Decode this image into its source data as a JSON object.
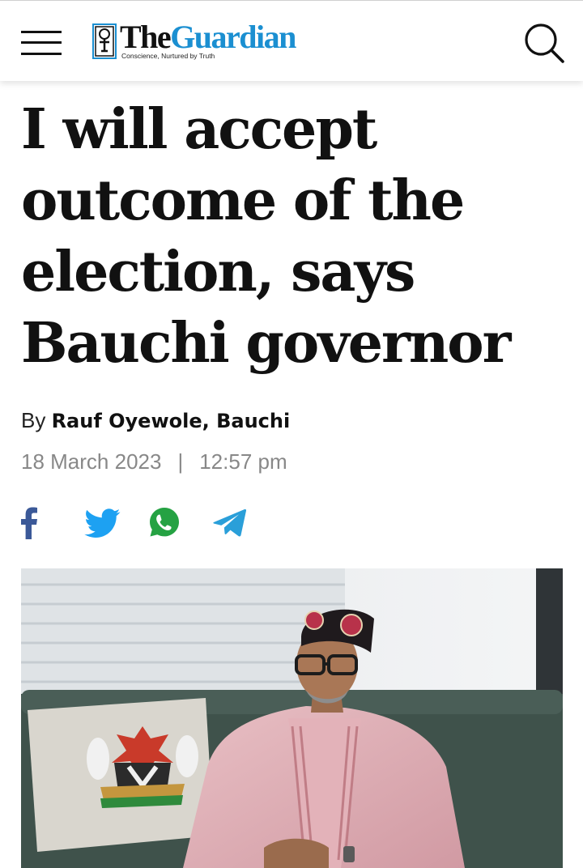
{
  "header": {
    "menu_icon": "hamburger-menu-icon",
    "logo": {
      "the": "The",
      "guardian": "Guardian",
      "tagline": "Conscience, Nurtured by Truth"
    },
    "search_icon": "search-icon"
  },
  "article": {
    "headline": "I will accept outcome of the election, says Bauchi governor",
    "byline_prefix": "By",
    "author": "Rauf Oyewole, Bauchi",
    "date": "18 March 2023",
    "separator": "|",
    "time": "12:57 pm"
  },
  "share": {
    "icons": [
      "facebook-icon",
      "twitter-icon",
      "whatsapp-icon",
      "telegram-icon"
    ]
  },
  "colors": {
    "brand_blue": "#1b8fd1",
    "facebook": "#3b5998",
    "twitter": "#1da1f2",
    "whatsapp": "#25a243",
    "telegram": "#2a9fd9"
  }
}
